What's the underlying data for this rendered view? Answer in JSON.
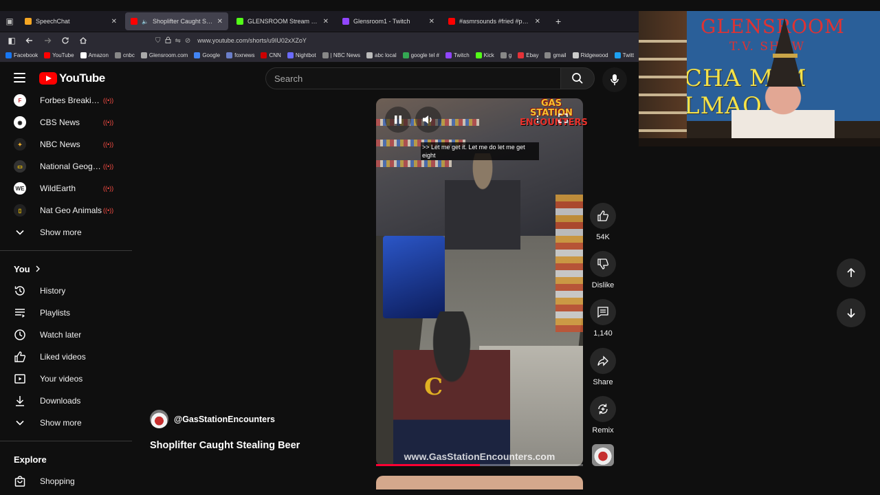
{
  "browser": {
    "tabs": [
      {
        "title": "SpeechChat",
        "color": "#f5a623",
        "active": false
      },
      {
        "title": "Shoplifter Caught Stealing",
        "color": "#ff0000",
        "active": true,
        "audio": true
      },
      {
        "title": "GLENSROOM Stream - Watch L",
        "color": "#53fc18",
        "active": false
      },
      {
        "title": "Glensroom1 - Twitch",
        "color": "#9146ff",
        "active": false
      },
      {
        "title": "#asmrsounds #fried #pork #st",
        "color": "#ff0000",
        "active": false
      }
    ],
    "url": "www.youtube.com/shorts/u9IU02xXZoY",
    "bookmarks": [
      {
        "label": "Facebook",
        "color": "#1877f2"
      },
      {
        "label": "YouTube",
        "color": "#ff0000"
      },
      {
        "label": "Amazon",
        "color": "#ffffff"
      },
      {
        "label": "cnbc",
        "color": "#888888"
      },
      {
        "label": "Glensroom.com",
        "color": "#aaaaaa"
      },
      {
        "label": "Google",
        "color": "#4285f4"
      },
      {
        "label": "foxnews",
        "color": "#6a7ec9"
      },
      {
        "label": "CNN",
        "color": "#cc0000"
      },
      {
        "label": "Nightbot",
        "color": "#6b6bff"
      },
      {
        "label": "| NBC News",
        "color": "#888888"
      },
      {
        "label": "abc local",
        "color": "#bbbbbb"
      },
      {
        "label": "google tel #",
        "color": "#34a853"
      },
      {
        "label": "Twitch",
        "color": "#9146ff"
      },
      {
        "label": "Kick",
        "color": "#53fc18"
      },
      {
        "label": "g",
        "color": "#888888"
      },
      {
        "label": "Ebay",
        "color": "#e53238"
      },
      {
        "label": "gmail",
        "color": "#888888"
      },
      {
        "label": "Ridgewood",
        "color": "#cccccc"
      },
      {
        "label": "Twitt",
        "color": "#1da1f2"
      }
    ]
  },
  "youtube": {
    "logo_text": "YouTube",
    "search_placeholder": "Search"
  },
  "sidebar": {
    "subscriptions": [
      {
        "label": "Forbes Breaking ...",
        "icon": "F",
        "icon_bg": "#ffffff",
        "icon_fg": "#c1272d",
        "live": true
      },
      {
        "label": "CBS News",
        "icon": "◉",
        "icon_bg": "#ffffff",
        "icon_fg": "#111111",
        "live": true
      },
      {
        "label": "NBC News",
        "icon": "✦",
        "icon_bg": "#222222",
        "icon_fg": "#f7b32b",
        "live": true
      },
      {
        "label": "National Geogra...",
        "icon": "▭",
        "icon_bg": "#333333",
        "icon_fg": "#ffce00",
        "live": true
      },
      {
        "label": "WildEarth",
        "icon": "WE",
        "icon_bg": "#ffffff",
        "icon_fg": "#222222",
        "live": true
      },
      {
        "label": "Nat Geo Animals",
        "icon": "▯",
        "icon_bg": "#222222",
        "icon_fg": "#ffce00",
        "live": true
      }
    ],
    "subs_show_more": "Show more",
    "you_heading": "You",
    "you_items": [
      {
        "label": "History",
        "icon": "history-icon"
      },
      {
        "label": "Playlists",
        "icon": "playlists-icon"
      },
      {
        "label": "Watch later",
        "icon": "clock-icon"
      },
      {
        "label": "Liked videos",
        "icon": "thumb-up-icon"
      },
      {
        "label": "Your videos",
        "icon": "video-icon"
      },
      {
        "label": "Downloads",
        "icon": "download-icon"
      }
    ],
    "you_show_more": "Show more",
    "explore_heading": "Explore",
    "explore_items": [
      {
        "label": "Shopping",
        "icon": "shopping-bag-icon"
      }
    ]
  },
  "short": {
    "caption": ">> Let me get it. Let me do let me get eight",
    "watermark_top_line1": "GAS STATION",
    "watermark_top_line2": "ENCOUNTERS",
    "watermark_bottom": "www.GasStationEncounters.com",
    "progress": 0.5,
    "channel": "@GasStationEncounters",
    "title": "Shoplifter Caught Stealing Beer"
  },
  "actions": {
    "like_count": "54K",
    "dislike_label": "Dislike",
    "comment_count": "1,140",
    "share_label": "Share",
    "remix_label": "Remix"
  },
  "webcam": {
    "banner_line1": "GLENSROOM",
    "banner_line2": "T.V. SHOW",
    "banner_line3": "CHA M M LMAO"
  }
}
